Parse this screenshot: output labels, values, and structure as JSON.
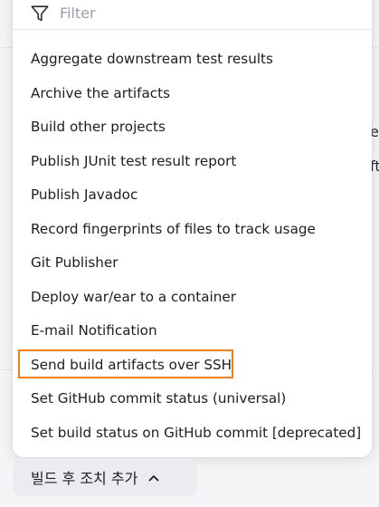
{
  "filter": {
    "placeholder": "Filter",
    "icon": "filter-icon"
  },
  "menu": {
    "items": [
      {
        "label": "Aggregate downstream test results"
      },
      {
        "label": "Archive the artifacts"
      },
      {
        "label": "Build other projects"
      },
      {
        "label": "Publish JUnit test result report"
      },
      {
        "label": "Publish Javadoc"
      },
      {
        "label": "Record fingerprints of files to track usage"
      },
      {
        "label": "Git Publisher"
      },
      {
        "label": "Deploy war/ear to a container"
      },
      {
        "label": "E-mail Notification"
      },
      {
        "label": "Send build artifacts over SSH",
        "highlighted": true
      },
      {
        "label": "Set GitHub commit status (universal)"
      },
      {
        "label": "Set build status on GitHub commit [deprecated]"
      }
    ],
    "highlight_color": "#f07f1d"
  },
  "add_action_button": {
    "label": "빌드 후 조치 추가",
    "icon": "chevron-up-icon"
  },
  "background": {
    "snippet_1": "e",
    "snippet_2": "ft"
  }
}
